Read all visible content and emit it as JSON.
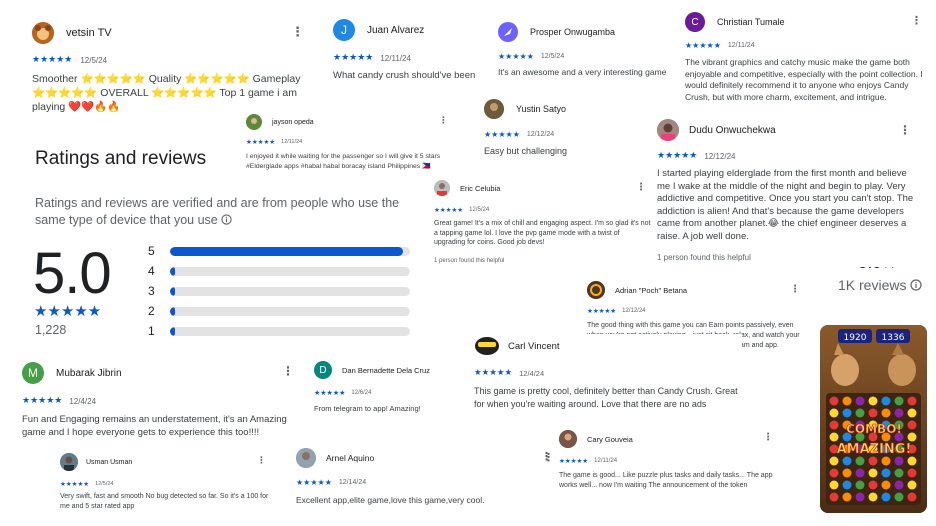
{
  "ratings": {
    "title": "Ratings and reviews",
    "description": "Ratings and reviews are verified and are from people who use the same type of device that you use",
    "info_icon": "info-icon",
    "score": "5.0",
    "stars": "★★★★★",
    "count": "1,228",
    "bars": [
      {
        "label": "5",
        "fraction": 0.97
      },
      {
        "label": "4",
        "fraction": 0.02
      },
      {
        "label": "3",
        "fraction": 0.02
      },
      {
        "label": "2",
        "fraction": 0.02
      },
      {
        "label": "1",
        "fraction": 0.02
      }
    ]
  },
  "summary": {
    "score": "5.0★",
    "reviews": "1K reviews",
    "info_icon": "info-icon"
  },
  "colors": {
    "star": "#0b57d0",
    "bar_track": "#e3e3e3",
    "text": "#202124",
    "secondary": "#5f6368"
  },
  "reviews": {
    "vetsin": {
      "name": "vetsin TV",
      "date": "12/5/24",
      "stars": "★★★★★",
      "text": "Smoother ⭐⭐⭐⭐⭐ Quality ⭐⭐⭐⭐⭐ Gameplay ⭐⭐⭐⭐⭐ OVERALL ⭐⭐⭐⭐⭐ Top 1 game i am playing ❤️❤️🔥🔥"
    },
    "juan": {
      "name": "Juan Alvarez",
      "initial": "J",
      "date": "12/11/24",
      "stars": "★★★★★",
      "text": "What candy crush should've been"
    },
    "prosper": {
      "name": "Prosper Onwugamba",
      "date": "12/5/24",
      "stars": "★★★★★",
      "text": "It's an awesome and a very interesting game"
    },
    "christian": {
      "name": "Christian Tumale",
      "initial": "C",
      "date": "12/11/24",
      "stars": "★★★★★",
      "text": "The vibrant graphics and catchy music make the game both enjoyable and competitive, especially with the point collection. I would definitely recommend it to anyone who enjoys Candy Crush, but with more charm, excitement, and intrigue."
    },
    "jayson": {
      "name": "jayson opeda",
      "date": "12/11/24",
      "stars": "★★★★★",
      "text": "I enjoyed it while waiting for the passenger so I will give it 5 stars #Elderglade apps #habal habal boracay island Philippines 🇵🇭"
    },
    "yustin": {
      "name": "Yustin Satyo",
      "date": "12/12/24",
      "stars": "★★★★★",
      "text": "Easy but challenging"
    },
    "dudu": {
      "name": "Dudu Onwuchekwa",
      "date": "12/12/24",
      "stars": "★★★★★",
      "text": "I started playing elderglade from the first month and believe me I wake at the middle of the night and begin to play. Very addictive and competitive. Once you start you can't stop. The addiction is alien! And that's because the game developers came from another planet.😂 the chief engineer deserves a raise. A job well done.",
      "helpful": "1 person found this helpful"
    },
    "eric": {
      "name": "Eric Celubia",
      "date": "12/5/24",
      "stars": "★★★★★",
      "text": "Great game! It's a mix of chill and engaging aspect. I'm so glad it's not a tapping game lol. I love the pvp game mode with a twist of upgrading for coins. Good job devs!",
      "helpful": "1 person found this helpful"
    },
    "adrian": {
      "name": "Adrian \"Poch\" Betana",
      "date": "12/12/24",
      "stars": "★★★★★",
      "text": "The good thing with this game you can Earn points passively, even when you're not actively playing—just sit back, relax, and watch your points grow! Synced your account between telegram and app."
    },
    "carl": {
      "name": "Carl Vincent",
      "date": "12/4/24",
      "stars": "★★★★★",
      "text": "This game is pretty cool, definitely better than Candy Crush. Great for when you're waiting around. Love that there are no ads"
    },
    "mubarak": {
      "name": "Mubarak Jibrin",
      "initial": "M",
      "date": "12/4/24",
      "stars": "★★★★★",
      "text": "Fun and Engaging remains an understatement, it's an Amazing game and I hope everyone gets to experience this too!!!!"
    },
    "dan": {
      "name": "Dan Bernadette Dela Cruz",
      "initial": "D",
      "date": "12/6/24",
      "stars": "★★★★★",
      "text": "From telegram to app! Amazing!"
    },
    "usman": {
      "name": "Usman Usman",
      "date": "12/5/24",
      "stars": "★★★★★",
      "text": "Very swift, fast and smooth No bug detected so far. So it's a 100 for me and 5 star rated app"
    },
    "arnel": {
      "name": "Arnel Aquino",
      "date": "12/14/24",
      "stars": "★★★★★",
      "text": "Excellent app,elite game,love this game,very cool."
    },
    "cary": {
      "name": "Cary Gouveia",
      "date": "12/11/24",
      "stars": "★★★★★",
      "text": "The game is good... Like puzzle plus tasks and daily tasks... The app works well... now I'm waiting The announcement of the token"
    }
  },
  "menu_glyph": "⋮",
  "game": {
    "score_left": "1920",
    "score_right": "1336",
    "combo_text": "COMBO!",
    "amazing_text": "AMAZING!"
  }
}
